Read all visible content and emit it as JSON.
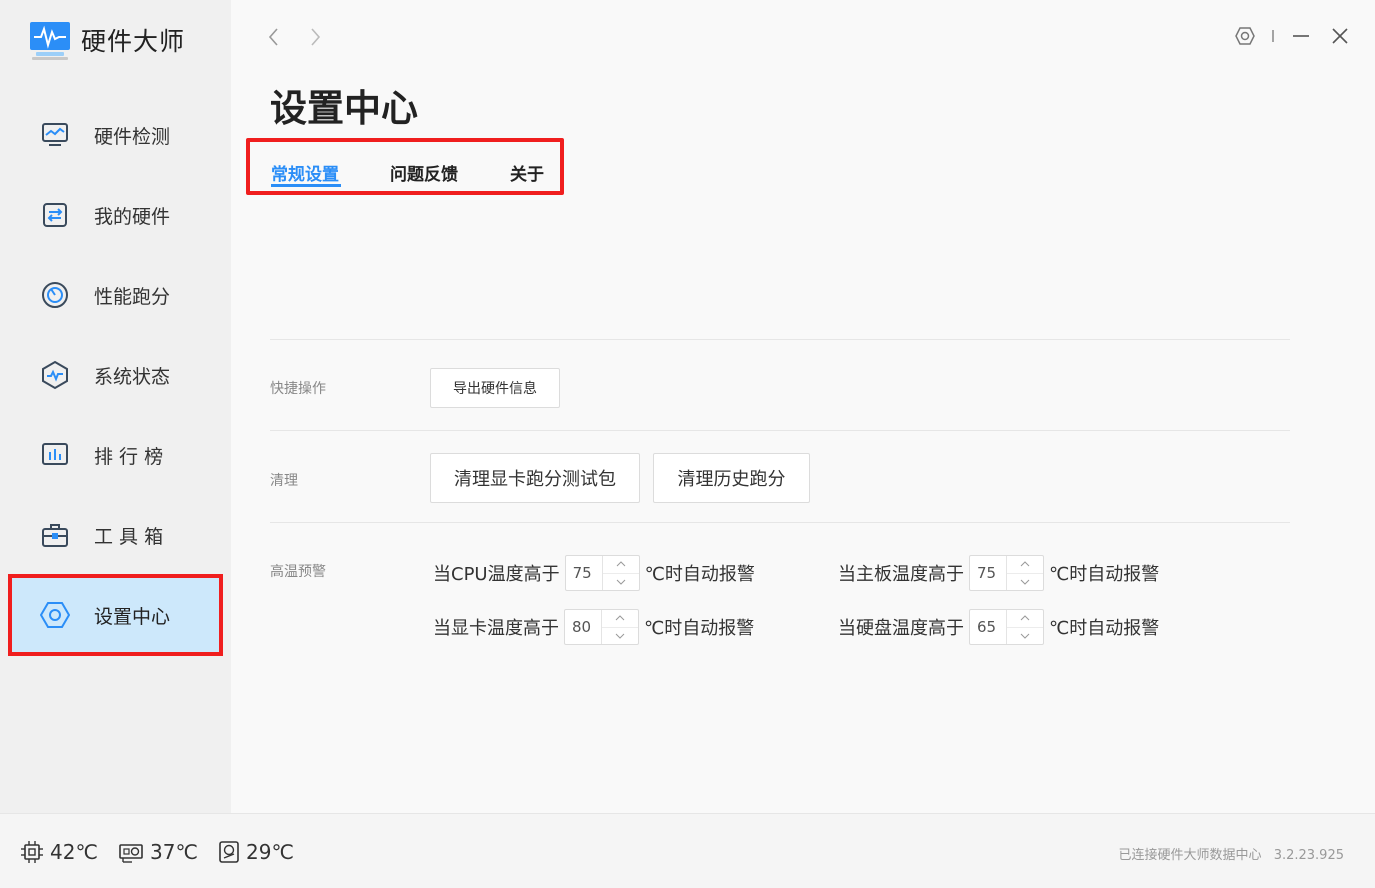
{
  "app": {
    "title": "硬件大师"
  },
  "sidebar": {
    "items": [
      {
        "label": "硬件检测",
        "icon": "monitor-chart-icon"
      },
      {
        "label": "我的硬件",
        "icon": "hardware-board-icon"
      },
      {
        "label": "性能跑分",
        "icon": "speedometer-icon"
      },
      {
        "label": "系统状态",
        "icon": "hexagon-pulse-icon"
      },
      {
        "label": "排 行 榜",
        "icon": "bar-ranking-icon"
      },
      {
        "label": "工 具 箱",
        "icon": "toolbox-icon"
      },
      {
        "label": "设置中心",
        "icon": "settings-hexagon-icon",
        "active": true
      }
    ]
  },
  "main": {
    "title": "设置中心",
    "tabs": [
      {
        "label": "常规设置",
        "active": true
      },
      {
        "label": "问题反馈"
      },
      {
        "label": "关于"
      }
    ],
    "shortcut": {
      "label": "快捷操作",
      "export_button": "导出硬件信息"
    },
    "cleanup": {
      "label": "清理",
      "clear_gpu_button": "清理显卡跑分测试包",
      "clear_history_button": "清理历史跑分"
    },
    "warning": {
      "label": "高温预警",
      "cpu": {
        "prefix": "当CPU温度高于",
        "value": "75",
        "suffix": "℃时自动报警"
      },
      "board": {
        "prefix": "当主板温度高于",
        "value": "75",
        "suffix": "℃时自动报警"
      },
      "gpu": {
        "prefix": "当显卡温度高于",
        "value": "80",
        "suffix": "℃时自动报警"
      },
      "disk": {
        "prefix": "当硬盘温度高于",
        "value": "65",
        "suffix": "℃时自动报警"
      }
    }
  },
  "statusbar": {
    "cpu_temp": "42℃",
    "gpu_temp": "37℃",
    "disk_temp": "29℃",
    "connection": "已连接硬件大师数据中心",
    "version": "3.2.23.925"
  },
  "colors": {
    "accent": "#2b8ef7",
    "highlight_border": "#f01e1e",
    "active_nav_bg": "#cde8fb"
  }
}
